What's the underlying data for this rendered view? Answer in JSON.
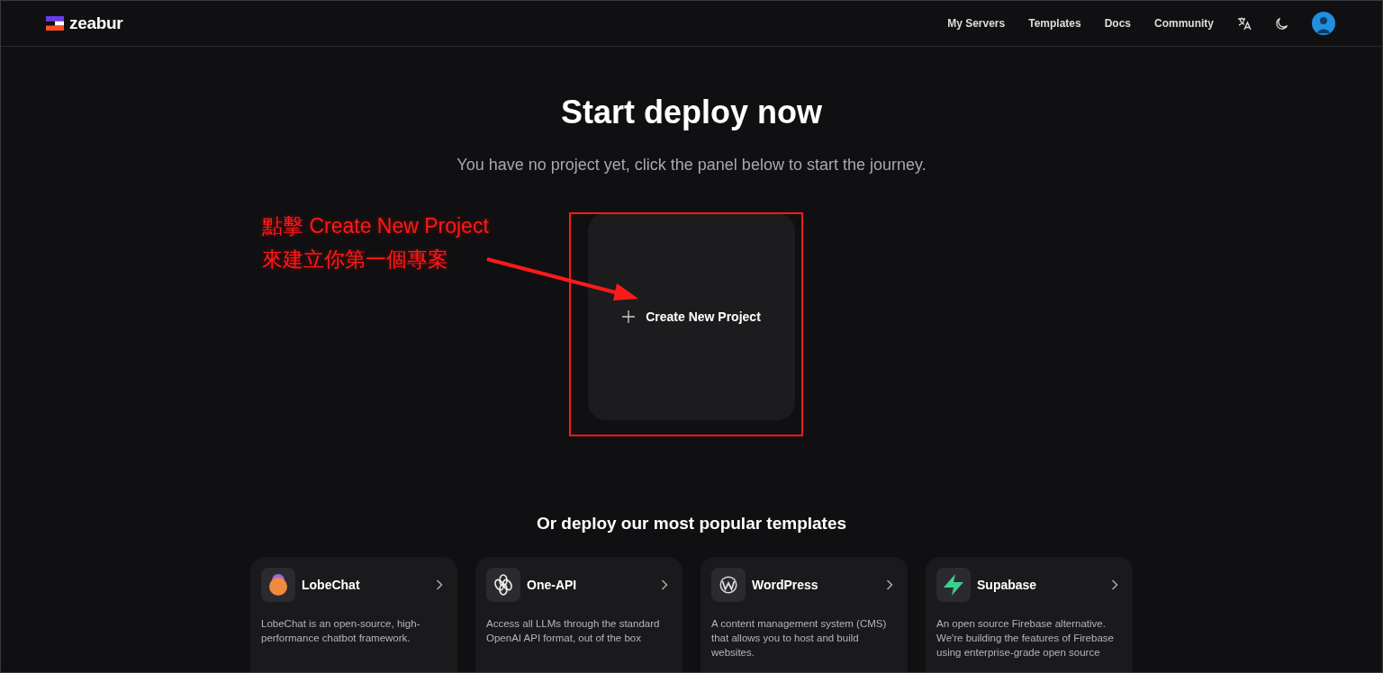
{
  "header": {
    "logo": "zeabur",
    "nav": [
      "My Servers",
      "Templates",
      "Docs",
      "Community"
    ]
  },
  "hero": {
    "title": "Start deploy now",
    "subtitle": "You have no project yet, click the panel below to start the journey."
  },
  "create_project": {
    "label": "Create New Project"
  },
  "annotation": {
    "lines": [
      "點擊 Create New Project",
      "來建立你第一個專案"
    ]
  },
  "templates": {
    "heading": "Or deploy our most popular templates",
    "items": [
      {
        "name": "LobeChat",
        "description": "LobeChat is an open-source, high-performance chatbot framework."
      },
      {
        "name": "One-API",
        "description": "Access all LLMs through the standard OpenAI API format, out of the box"
      },
      {
        "name": "WordPress",
        "description": "A content management system (CMS) that allows you to host and build websites."
      },
      {
        "name": "Supabase",
        "description": "An open source Firebase alternative. We're building the features of Firebase using enterprise-grade open source"
      }
    ]
  }
}
